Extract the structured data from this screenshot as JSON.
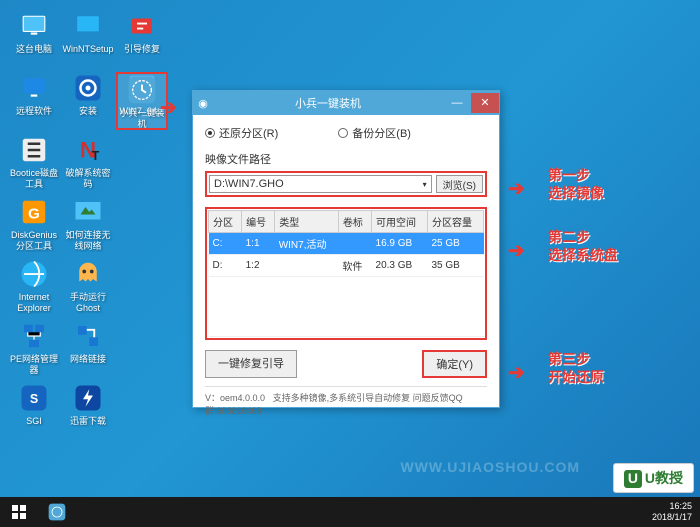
{
  "desktop": {
    "icons": [
      {
        "label": "这台电脑",
        "color": "#4fc3f7"
      },
      {
        "label": "WinNTSetup",
        "color": "#29b6f6"
      },
      {
        "label": "引导修复",
        "color": "#e53935"
      },
      {
        "label": "远程软件",
        "color": "#1e88e5"
      },
      {
        "label": "安装",
        "color": "#1565c0"
      },
      {
        "label": "WIN7_64...",
        "color": "#42a5f5"
      },
      {
        "label": "小兵一键装机",
        "color": "#4fa8d8"
      },
      {
        "label": "Bootice磁盘工具",
        "color": "#eeeeee"
      },
      {
        "label": "破解系统密码",
        "color": "#212121"
      },
      {
        "label": "DiskGenius分区工具",
        "color": "#ff9800"
      },
      {
        "label": "如何连接无线网络",
        "color": "#4fc3f7"
      },
      {
        "label": "Internet Explorer",
        "color": "#29b6f6"
      },
      {
        "label": "手动运行Ghost",
        "color": "#ffb74d"
      },
      {
        "label": "PE网络管理器",
        "color": "#1976d2"
      },
      {
        "label": "网络链接",
        "color": "#1976d2"
      },
      {
        "label": "SGI",
        "color": "#1565c0"
      },
      {
        "label": "迅雷下载",
        "color": "#0d47a1"
      }
    ]
  },
  "window": {
    "title": "小兵一键装机",
    "radio_restore": "还原分区(R)",
    "radio_backup": "备份分区(B)",
    "path_label": "映像文件路径",
    "path_value": "D:\\WIN7.GHO",
    "browse_btn": "浏览(S)",
    "columns": [
      "分区",
      "编号",
      "类型",
      "卷标",
      "可用空间",
      "分区容量"
    ],
    "rows": [
      {
        "part": "C:",
        "num": "1:1",
        "type": "WIN7,活动",
        "vol": "",
        "free": "16.9 GB",
        "size": "25 GB",
        "selected": true
      },
      {
        "part": "D:",
        "num": "1:2",
        "type": "",
        "vol": "软件",
        "free": "20.3 GB",
        "size": "35 GB",
        "selected": false
      }
    ],
    "repair_btn": "一键修复引导",
    "confirm_btn": "确定(Y)",
    "status_version": "V：oem4.0.0.0",
    "status_text": "支持多种镜像,多系统引导自动修复 问题反馈QQ群:606616468"
  },
  "annotations": {
    "step1_title": "第一步",
    "step1_text": "选择镜像",
    "step2_title": "第二步",
    "step2_text": "选择系统盘",
    "step3_title": "第三步",
    "step3_text": "开始还原"
  },
  "taskbar": {
    "time": "16:25",
    "date": "2018/1/17"
  },
  "watermark": {
    "site": "WWW.UJIAOSHOU.COM",
    "logo_text": "U教授"
  }
}
